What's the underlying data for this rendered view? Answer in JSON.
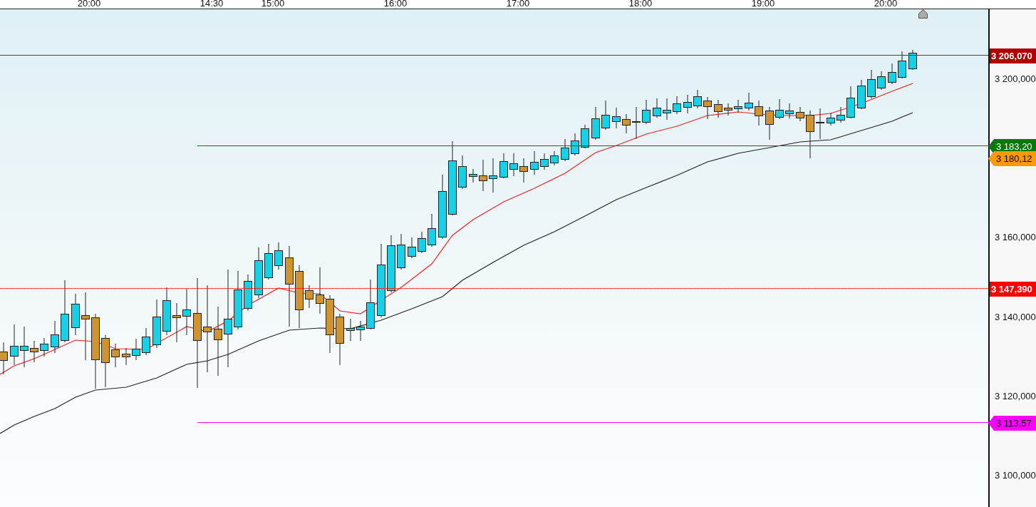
{
  "time_axis": {
    "labels": [
      "20:00",
      "14:30",
      "15:00",
      "16:00",
      "17:00",
      "18:00",
      "19:00",
      "20:00"
    ]
  },
  "price_axis": {
    "labels": [
      "3 200,000",
      "3 160,000",
      "3 140,000",
      "3 120,000",
      "3 100,000"
    ]
  },
  "price_tags": [
    {
      "text": "3 206,070",
      "kind": "box",
      "color": "#b00000",
      "line": true,
      "dotted": false
    },
    {
      "text": "3 183,20",
      "kind": "pointer",
      "color": "#087808",
      "line": true,
      "dotted": false
    },
    {
      "text": "3 180,12",
      "kind": "pointer",
      "color": "#ff9900",
      "line": false
    },
    {
      "text": "3 147,390",
      "kind": "box",
      "color": "#ff0000",
      "line": true,
      "dotted": true
    },
    {
      "text": "3 113,57",
      "kind": "pointer",
      "color": "#ff00ff",
      "line": true,
      "dotted": false
    }
  ]
}
